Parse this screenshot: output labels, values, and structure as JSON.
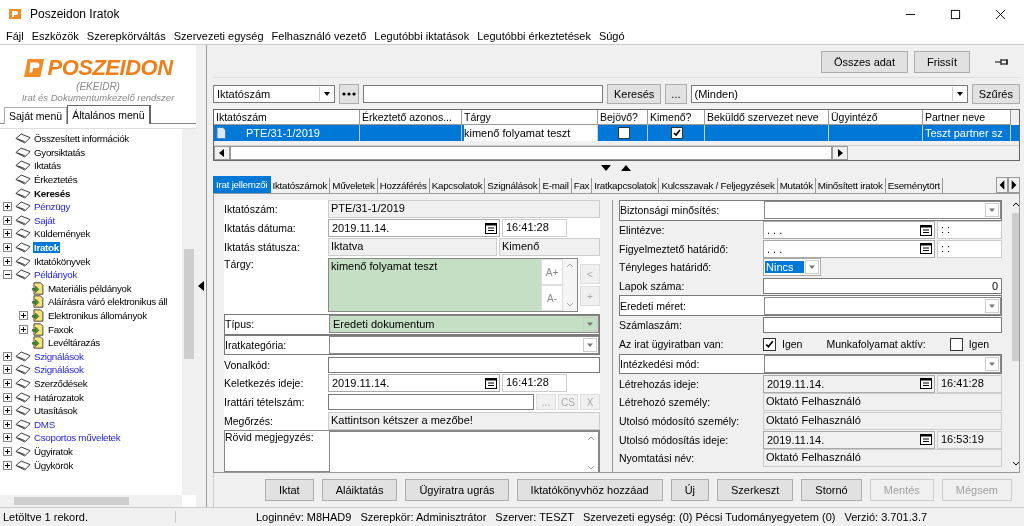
{
  "window": {
    "title": "Poszeidon Iratok"
  },
  "menu": [
    "Fájl",
    "Eszközök",
    "Szerepkörváltás",
    "Szervezeti egység",
    "Felhasználó vezető",
    "Legutóbbi iktatások",
    "Legutóbbi érkeztetések",
    "Súgó"
  ],
  "sidebar": {
    "logo": {
      "name": "POSZEIDON",
      "code": "(EKEIDR)",
      "tagline": "Irat és Dokumentumkezelő rendszer"
    },
    "tabs": [
      {
        "label": "Saját menü",
        "selected": false
      },
      {
        "label": "Általános menü",
        "selected": true
      }
    ],
    "tree": [
      {
        "label": "Összesített információk",
        "kind": "plain",
        "selected": false
      },
      {
        "label": "Gyorsiktatás",
        "kind": "plain",
        "selected": false
      },
      {
        "label": "Iktatás",
        "kind": "plain",
        "selected": false
      },
      {
        "label": "Érkeztetés",
        "kind": "plain",
        "selected": false
      },
      {
        "label": "Keresés",
        "kind": "bold",
        "selected": false
      },
      {
        "label": "Pénzügy",
        "kind": "link",
        "selected": false,
        "expanded": false
      },
      {
        "label": "Saját",
        "kind": "link",
        "selected": false,
        "expanded": false
      },
      {
        "label": "Küldemények",
        "kind": "plain",
        "selected": false,
        "expanded": false
      },
      {
        "label": "Iratok",
        "kind": "plain",
        "selected": true,
        "expanded": false
      },
      {
        "label": "Iktatókönyvek",
        "kind": "plain",
        "selected": false,
        "expanded": false
      },
      {
        "label": "Példányok",
        "kind": "link",
        "selected": false,
        "expanded": true,
        "children": [
          {
            "label": "Materiális példányok",
            "kind": "plain",
            "selected": false
          },
          {
            "label": "Aláírásra váró elektronikus áll",
            "kind": "plain",
            "selected": false
          },
          {
            "label": "Elektronikus állományok",
            "kind": "plain",
            "selected": false,
            "expanded": false
          },
          {
            "label": "Faxok",
            "kind": "plain",
            "selected": false,
            "expanded": false
          },
          {
            "label": "Levéltárazás",
            "kind": "plain",
            "selected": false
          }
        ]
      },
      {
        "label": "Szignálások",
        "kind": "link",
        "selected": false,
        "expanded": false
      },
      {
        "label": "Szignálások",
        "kind": "link",
        "selected": false,
        "expanded": false
      },
      {
        "label": "Szerződések",
        "kind": "plain",
        "selected": false,
        "expanded": false
      },
      {
        "label": "Határozatok",
        "kind": "plain",
        "selected": false,
        "expanded": false
      },
      {
        "label": "Utasítások",
        "kind": "plain",
        "selected": false,
        "expanded": false
      },
      {
        "label": "DMS",
        "kind": "link",
        "selected": false,
        "expanded": false
      },
      {
        "label": "Csoportos műveletek",
        "kind": "link",
        "selected": false,
        "expanded": false
      },
      {
        "label": "Ügyiratok",
        "kind": "plain",
        "selected": false,
        "expanded": false
      },
      {
        "label": "Ügykörök",
        "kind": "plain",
        "selected": false,
        "expanded": false
      }
    ]
  },
  "toolbar": {
    "buttons": [
      "Összes adat",
      "Frissít"
    ]
  },
  "search": {
    "field_combo": "Iktatószám",
    "search_button": "Keresés",
    "browse_button": "...",
    "filter_combo": "(Minden)",
    "filter_button": "Szűrés"
  },
  "table": {
    "columns": [
      "Iktatószám",
      "Érkeztető azonos...",
      "Tárgy",
      "Bejövő?",
      "Kimenő?",
      "Beküldő szervezet neve",
      "Ügyintéző",
      "Partner neve"
    ],
    "rows": [
      {
        "selected": true,
        "cells": [
          {
            "text": "PTE/31-1/2019"
          },
          {},
          {
            "text": "kimenő folyamat teszt"
          },
          {
            "checked": false
          },
          {
            "checked": true
          },
          {},
          {},
          {
            "text": "Teszt partner sz"
          }
        ]
      }
    ]
  },
  "tabs": [
    {
      "label": "Irat jellemzői",
      "selected": true
    },
    {
      "label": "Iktatószámok",
      "selected": false
    },
    {
      "label": "Műveletek",
      "selected": false
    },
    {
      "label": "Hozzáférés",
      "selected": false
    },
    {
      "label": "Kapcsolatok",
      "selected": false
    },
    {
      "label": "Szignálások",
      "selected": false
    },
    {
      "label": "E-mail",
      "selected": false
    },
    {
      "label": "Fax",
      "selected": false
    },
    {
      "label": "Iratkapcsolatok",
      "selected": false
    },
    {
      "label": "Kulcsszavak / Feljegyzések",
      "selected": false
    },
    {
      "label": "Mutatók",
      "selected": false
    },
    {
      "label": "Minősített iratok",
      "selected": false
    },
    {
      "label": "Eseménytört",
      "selected": false
    }
  ],
  "form": {
    "left": [
      {
        "label": "Iktatószám:",
        "kind": "readonly",
        "value": "PTE/31-1/2019"
      },
      {
        "label": "Iktatás dátuma:",
        "kind": "datetime",
        "date": "2019.11.14.",
        "time": "16:41:28",
        "readonly": false
      },
      {
        "label": "Iktatás státusza:",
        "kind": "pair",
        "values": [
          "Iktatva",
          "Kimenő"
        ]
      },
      {
        "label": "Tárgy:",
        "kind": "subject",
        "value": "kimenő folyamat teszt",
        "required": true,
        "buttons": [
          "A+",
          "A-"
        ],
        "side_buttons": [
          "<",
          "+"
        ]
      },
      {
        "label": "Típus:",
        "kind": "combo",
        "value": "Eredeti dokumentum",
        "required": true
      },
      {
        "label": "Iratkategória:",
        "kind": "combo",
        "required": false
      },
      {
        "label": "Vonalkód:",
        "kind": "input"
      },
      {
        "label": "Keletkezés ideje:",
        "kind": "datetime",
        "date": "2019.11.14.",
        "time": "16:41:28",
        "readonly": false
      },
      {
        "label": "Irattári tételszám:",
        "kind": "picker",
        "buttons": [
          "...",
          "CS",
          "X"
        ]
      },
      {
        "label": "Megőrzés:",
        "kind": "readonly",
        "value": "Kattintson kétszer a mezőbe!"
      },
      {
        "label": "Rövid megjegyzés:",
        "kind": "memo"
      }
    ],
    "right": [
      {
        "label": "Biztonsági minősítés:",
        "kind": "combo",
        "required": false
      },
      {
        "label": "Elintézve:",
        "kind": "datetime",
        "date": ". . .",
        "time": ": :",
        "readonly": false
      },
      {
        "label": "Figyelmeztető határidő:",
        "kind": "datetime",
        "date": ". . .",
        "time": ": :",
        "readonly": false
      },
      {
        "label": "Tényleges határidő:",
        "kind": "smallcombo",
        "value": "Nincs",
        "highlighted": true
      },
      {
        "label": "Lapok száma:",
        "kind": "number",
        "value": "0"
      },
      {
        "label": "Eredeti méret:",
        "kind": "combo",
        "required": false
      },
      {
        "label": "Számlaszám:",
        "kind": "input"
      },
      {
        "label": "Az irat ügyiratban van:",
        "kind": "checks",
        "checks": [
          {
            "label": "Igen",
            "checked": true
          },
          {
            "caption": "Munkafolyamat aktív:",
            "label": "Igen",
            "checked": false
          }
        ]
      },
      {
        "label": "Intézkedési mód:",
        "kind": "combo",
        "required": false
      },
      {
        "label": "Létrehozás ideje:",
        "kind": "datetime",
        "date": "2019.11.14.",
        "time": "16:41:28",
        "readonly": true
      },
      {
        "label": "Létrehozó személy:",
        "kind": "readonly",
        "value": "Oktató Felhasználó"
      },
      {
        "label": "Utolsó módosító személy:",
        "kind": "readonly",
        "value": "Oktató Felhasználó"
      },
      {
        "label": "Utolsó módosítás ideje:",
        "kind": "datetime",
        "date": "2019.11.14.",
        "time": "16:53:19",
        "readonly": true
      },
      {
        "label": "Nyomtatási név:",
        "kind": "readonly",
        "value": "Oktató Felhasználó"
      }
    ]
  },
  "actions": [
    {
      "label": "Iktat",
      "disabled": false
    },
    {
      "label": "Aláiktatás",
      "disabled": false
    },
    {
      "label": "Ügyiratra ugrás",
      "disabled": false
    },
    {
      "label": "Iktatókönyvhöz hozzáad",
      "disabled": false
    },
    {
      "label": "Új",
      "disabled": false
    },
    {
      "label": "Szerkeszt",
      "disabled": false
    },
    {
      "label": "Stornó",
      "disabled": false
    },
    {
      "label": "Mentés",
      "disabled": true
    },
    {
      "label": "Mégsem",
      "disabled": true
    }
  ],
  "status_bar": {
    "message": "Letöltve 1 rekord.",
    "items": [
      "Loginnév: M8HAD9",
      "Szerepkör: Adminisztrátor",
      "Szerver: TESZT",
      "Szervezeti egység: (0) Pécsi Tudományegyetem (0)",
      "Verzió: 3.701.3.7"
    ]
  }
}
